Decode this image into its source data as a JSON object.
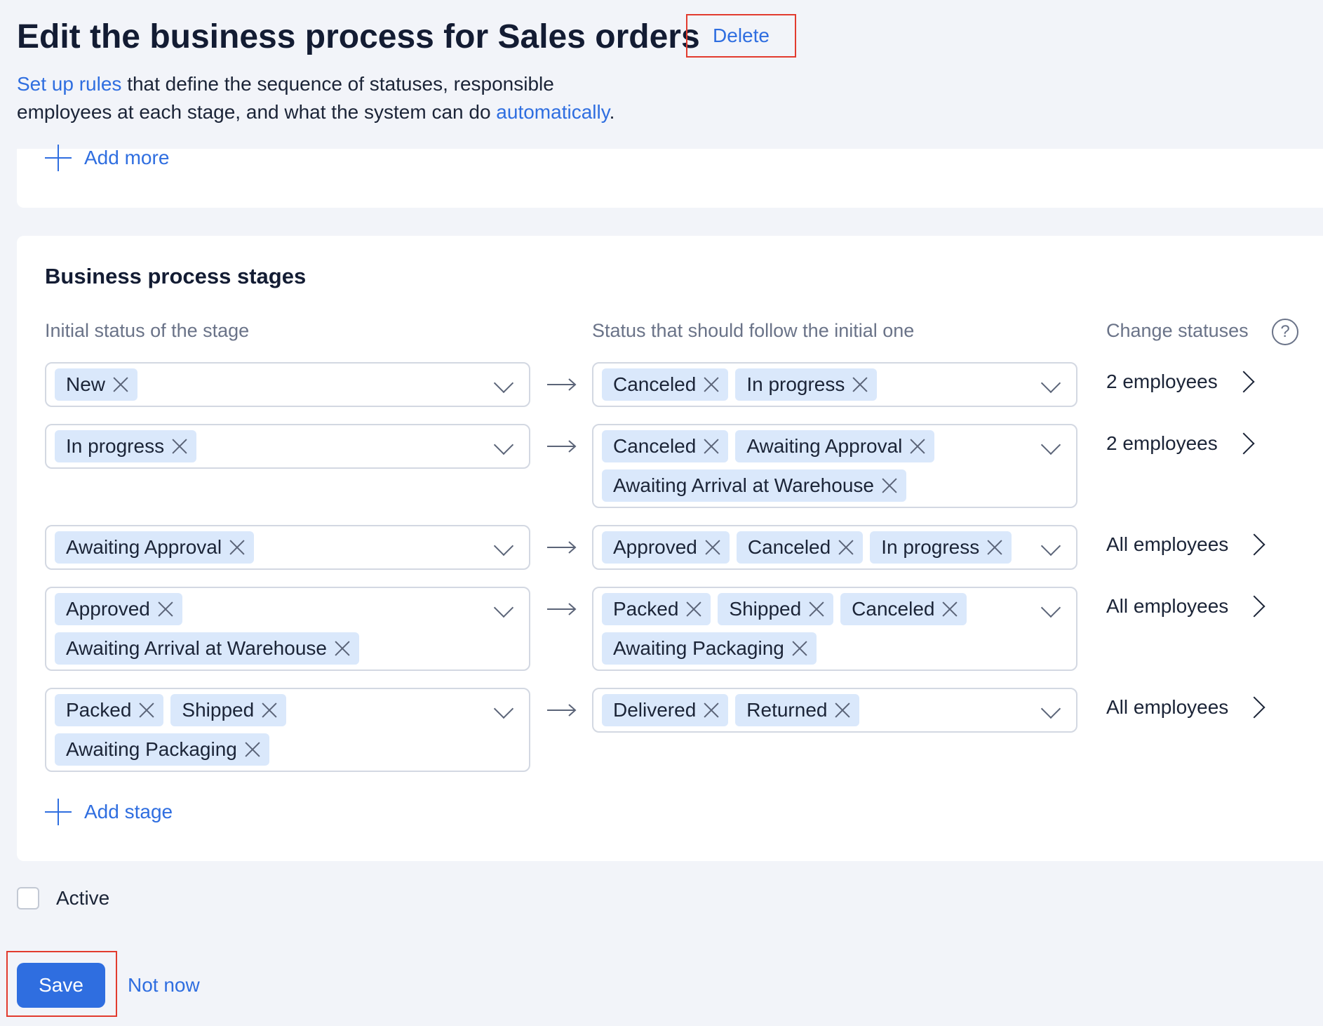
{
  "header": {
    "title": "Edit the business process for Sales orders",
    "delete_label": "Delete",
    "intro_link1": "Set up rules",
    "intro_text1": " that define the sequence of statuses, responsible employees at each stage, and what the system can do ",
    "intro_link2": "automatically",
    "intro_text2": "."
  },
  "top_card": {
    "add_more_label": "Add more"
  },
  "stages": {
    "title": "Business process stages",
    "col_initial": "Initial status of the stage",
    "col_next": "Status that should follow the initial one",
    "col_change": "Change statuses",
    "help_icon": "?",
    "rows": [
      {
        "initial": [
          "New"
        ],
        "next": [
          "Canceled",
          "In progress"
        ],
        "employees": "2 employees"
      },
      {
        "initial": [
          "In progress"
        ],
        "next": [
          "Canceled",
          "Awaiting Approval",
          "Awaiting Arrival at Warehouse"
        ],
        "employees": "2 employees"
      },
      {
        "initial": [
          "Awaiting Approval"
        ],
        "next": [
          "Approved",
          "Canceled",
          "In progress"
        ],
        "employees": "All employees"
      },
      {
        "initial": [
          "Approved",
          "Awaiting Arrival at Warehouse"
        ],
        "next": [
          "Packed",
          "Shipped",
          "Canceled",
          "Awaiting Packaging"
        ],
        "employees": "All employees"
      },
      {
        "initial": [
          "Packed",
          "Shipped",
          "Awaiting Packaging"
        ],
        "next": [
          "Delivered",
          "Returned"
        ],
        "employees": "All employees"
      }
    ],
    "add_stage_label": "Add stage"
  },
  "footer": {
    "active_label": "Active",
    "active_checked": false,
    "save_label": "Save",
    "not_now_label": "Not now"
  },
  "colors": {
    "accent": "#2f6ee0",
    "chip": "#dae8fb",
    "highlight": "#e23b2e"
  }
}
